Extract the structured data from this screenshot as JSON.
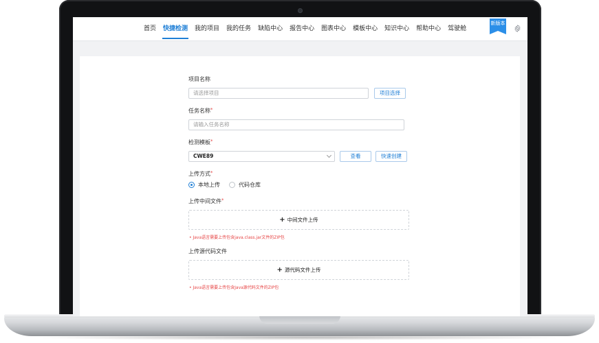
{
  "nav": {
    "items": [
      {
        "label": "首页"
      },
      {
        "label": "快捷检测"
      },
      {
        "label": "我的项目"
      },
      {
        "label": "我的任务"
      },
      {
        "label": "缺陷中心"
      },
      {
        "label": "报告中心"
      },
      {
        "label": "图表中心"
      },
      {
        "label": "模板中心"
      },
      {
        "label": "知识中心"
      },
      {
        "label": "帮助中心"
      },
      {
        "label": "驾驶舱"
      }
    ],
    "active": "快捷检测",
    "badge": "新版本",
    "settings_icon": "gear-icon"
  },
  "form": {
    "project": {
      "label": "项目名称",
      "placeholder": "请选择项目",
      "button": "项目选择"
    },
    "task": {
      "label": "任务名称",
      "required_mark": "*",
      "placeholder": "请输入任务名称"
    },
    "template": {
      "label": "检测模板",
      "required_mark": "*",
      "value": "CWE89",
      "view_button": "查看",
      "quick_create_button": "快速创建"
    },
    "upload_method": {
      "label": "上传方式",
      "required_mark": "*",
      "options": [
        {
          "label": "本地上传",
          "selected": true
        },
        {
          "label": "代码仓库",
          "selected": false
        }
      ]
    },
    "intermediate_file": {
      "label": "上传中间文件",
      "required_mark": "*",
      "button": "中间文件上传",
      "hint": "Java语言需要上传包含java.class.jar文件的ZIP包"
    },
    "source_file": {
      "label": "上传源代码文件",
      "button": "源代码文件上传",
      "hint": "Java语言需要上传包含Java源代码文件的ZIP包"
    }
  },
  "colors": {
    "accent": "#1f7fd6",
    "error": "#e64242",
    "badge": "#2c8fe8"
  }
}
